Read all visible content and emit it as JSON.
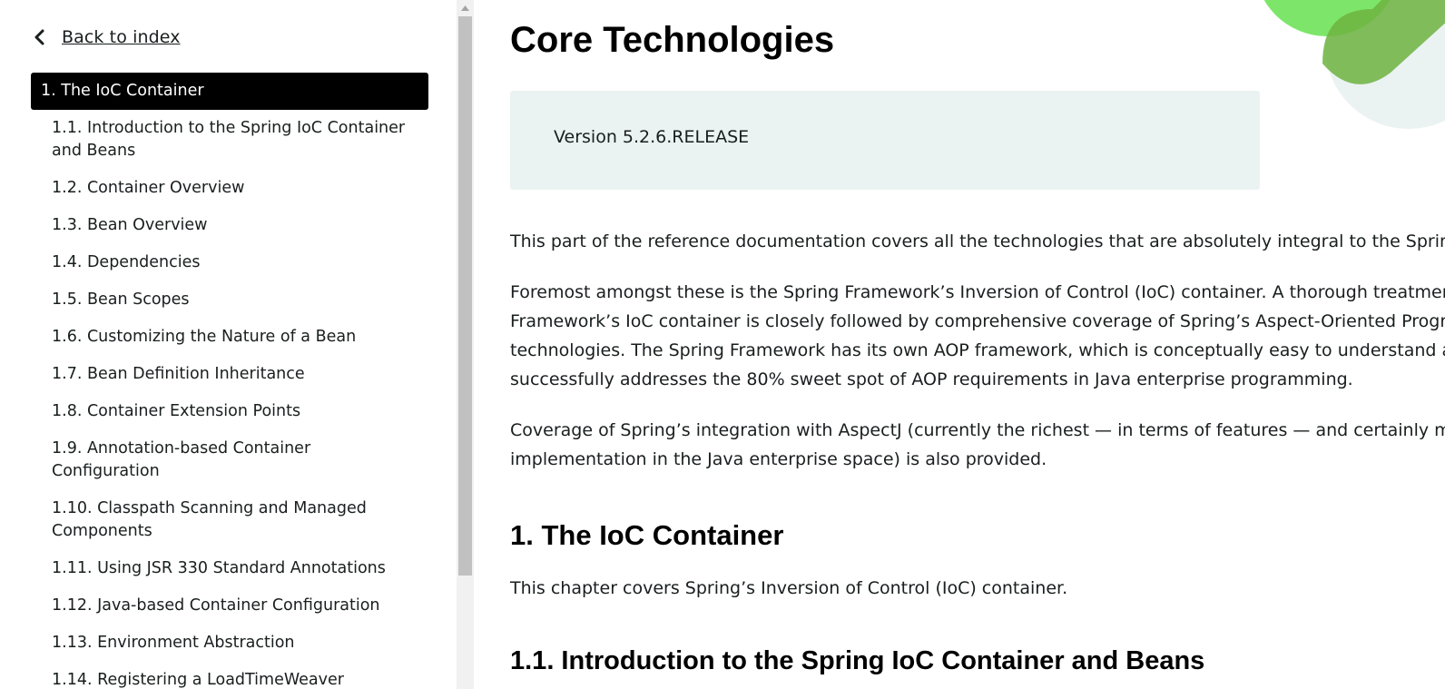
{
  "sidebar": {
    "back_label": "Back to index",
    "active_item": "1. The IoC Container",
    "items": [
      "1.1. Introduction to the Spring IoC Container and Beans",
      "1.2. Container Overview",
      "1.3. Bean Overview",
      "1.4. Dependencies",
      "1.5. Bean Scopes",
      "1.6. Customizing the Nature of a Bean",
      "1.7. Bean Definition Inheritance",
      "1.8. Container Extension Points",
      "1.9. Annotation-based Container Configuration",
      "1.10. Classpath Scanning and Managed Components",
      "1.11. Using JSR 330 Standard Annotations",
      "1.12. Java-based Container Configuration",
      "1.13. Environment Abstraction",
      "1.14. Registering a LoadTimeWeaver"
    ]
  },
  "main": {
    "title": "Core Technologies",
    "version": "Version 5.2.6.RELEASE",
    "intro_lines": [
      "This part of the reference documentation covers all the technologies that are absolutely integral to the Spring F"
    ],
    "para2_lines": [
      "Foremost amongst these is the Spring Framework’s Inversion of Control (IoC) container. A thorough treatment o",
      "Framework’s IoC container is closely followed by comprehensive coverage of Spring’s Aspect-Oriented Program",
      "technologies. The Spring Framework has its own AOP framework, which is conceptually easy to understand and",
      "successfully addresses the 80% sweet spot of AOP requirements in Java enterprise programming."
    ],
    "para3_lines": [
      "Coverage of Spring’s integration with AspectJ (currently the richest — in terms of features — and certainly most",
      "implementation in the Java enterprise space) is also provided."
    ],
    "section1_title": "1. The IoC Container",
    "section1_text": "This chapter covers Spring’s Inversion of Control (IoC) container.",
    "section1_1_title": "1.1. Introduction to the Spring IoC Container and Beans"
  },
  "colors": {
    "active_bg": "#000000",
    "version_bg": "#ebf2f2",
    "deco_green": "#6db33f",
    "deco_light_green": "#7de66a"
  }
}
